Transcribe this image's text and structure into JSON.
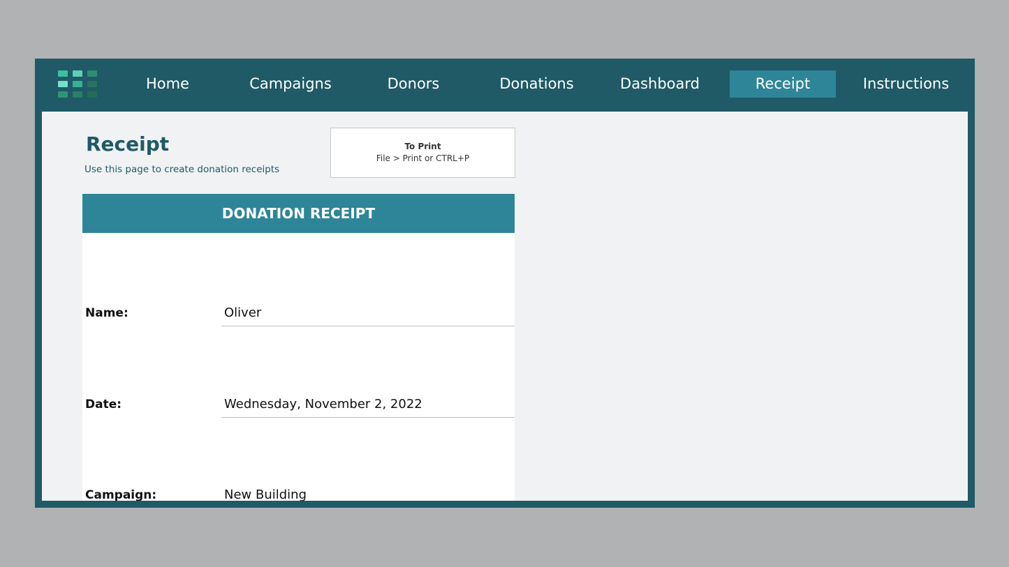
{
  "nav": {
    "logo_icon": "grid-logo-icon",
    "items": [
      {
        "label": "Home",
        "active": false
      },
      {
        "label": "Campaigns",
        "active": false
      },
      {
        "label": "Donors",
        "active": false
      },
      {
        "label": "Donations",
        "active": false
      },
      {
        "label": "Dashboard",
        "active": false
      },
      {
        "label": "Receipt",
        "active": true
      },
      {
        "label": "Instructions",
        "active": false
      }
    ]
  },
  "page": {
    "title": "Receipt",
    "subtitle": "Use this page to create donation receipts"
  },
  "print_box": {
    "title": "To Print",
    "help": "File > Print  or  CTRL+P"
  },
  "receipt": {
    "header": "DONATION RECEIPT",
    "fields": [
      {
        "label": "Name:",
        "value": "Oliver"
      },
      {
        "label": "Date:",
        "value": "Wednesday, November 2, 2022"
      },
      {
        "label": "Campaign:",
        "value": "New Building"
      }
    ]
  },
  "colors": {
    "frame": "#1f5a66",
    "accent": "#2e8597",
    "background": "#f0f2f4",
    "outer": "#b1b2b4"
  }
}
